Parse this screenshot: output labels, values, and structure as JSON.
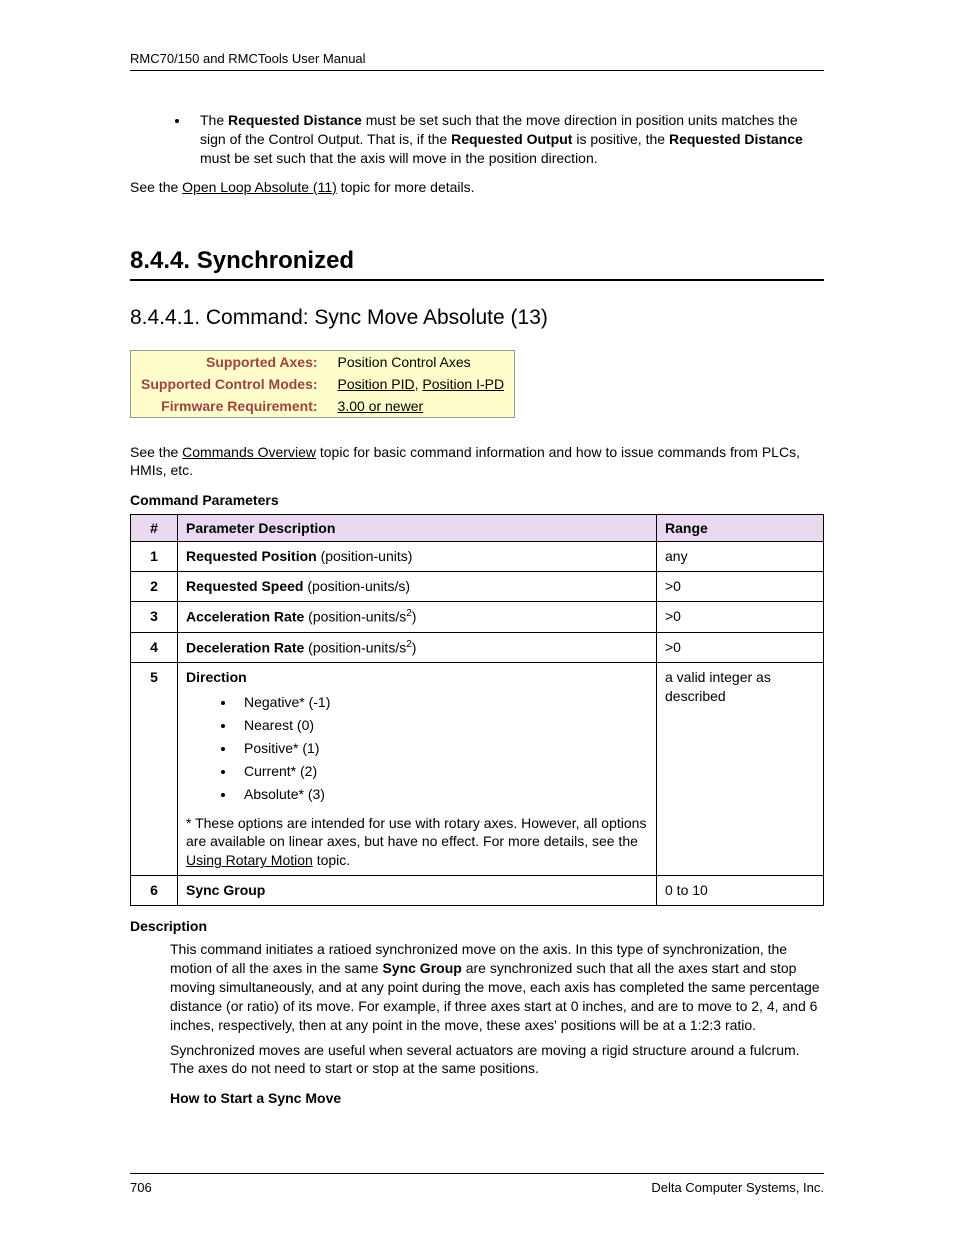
{
  "header": "RMC70/150 and RMCTools User Manual",
  "intro_bullet_pre": "The ",
  "intro_bullet_b1": "Requested Distance",
  "intro_bullet_mid1": " must be set such that the move direction in position units matches the sign of the Control Output. That is, if the ",
  "intro_bullet_b2": "Requested Output",
  "intro_bullet_mid2": " is positive, the ",
  "intro_bullet_b3": "Requested Distance",
  "intro_bullet_end": " must be set such that the axis will move in the position direction.",
  "see1_pre": "See the ",
  "see1_link": "Open Loop Absolute (11)",
  "see1_post": " topic for more details.",
  "h2": "8.4.4. Synchronized",
  "h3": "8.4.4.1. Command: Sync Move Absolute (13)",
  "info": {
    "r1l": "Supported Axes:",
    "r1v": "Position Control Axes",
    "r2l": "Supported Control Modes:",
    "r2v_a": "Position PID",
    "r2v_sep": ", ",
    "r2v_b": "Position I-PD",
    "r3l": "Firmware Requirement:",
    "r3v": "3.00 or newer"
  },
  "see2_pre": "See the ",
  "see2_link": "Commands Overview",
  "see2_post": " topic for basic command information and how to issue commands from PLCs, HMIs, etc.",
  "cmdparams_title": "Command Parameters",
  "th_num": "#",
  "th_desc": "Parameter Description",
  "th_range": "Range",
  "rows": {
    "r1": {
      "n": "1",
      "name": "Requested Position",
      "units": "  (position-units)",
      "range": "any"
    },
    "r2": {
      "n": "2",
      "name": "Requested Speed",
      "units": "  (position-units/s)",
      "range": ">0"
    },
    "r3": {
      "n": "3",
      "name": "Acceleration Rate",
      "units_pre": "  (position-units/s",
      "units_post": ")",
      "range": ">0"
    },
    "r4": {
      "n": "4",
      "name": "Deceleration Rate",
      "units_pre": "  (position-units/s",
      "units_post": ")",
      "range": ">0"
    },
    "r5": {
      "n": "5",
      "name": "Direction",
      "opts": {
        "a": "Negative* (-1)",
        "b": "Nearest (0)",
        "c": "Positive* (1)",
        "d": "Current* (2)",
        "e": "Absolute* (3)"
      },
      "note_pre": "* These options are intended for use with rotary axes. However, all options are available on linear axes, but have no effect. For more details, see the ",
      "note_link": "Using Rotary Motion",
      "note_post": " topic.",
      "range": "a valid integer as described"
    },
    "r6": {
      "n": "6",
      "name": "Sync Group",
      "range": "0 to 10"
    }
  },
  "desc_title": "Description",
  "desc_p1_pre": "This command initiates a ratioed synchronized move on the axis. In this type of synchronization, the motion of all the axes in the same ",
  "desc_p1_b": "Sync Group",
  "desc_p1_post": " are synchronized such that all the axes start and stop moving simultaneously, and at any point during the move, each axis has completed the same percentage distance (or ratio) of its move. For example, if three axes start at 0 inches, and are to move to 2, 4, and 6 inches, respectively, then at any point in the move, these axes' positions will be at a 1:2:3 ratio.",
  "desc_p2": "Synchronized moves are useful when several actuators are moving a rigid structure around a fulcrum. The axes do not need to start or stop at the same positions.",
  "howto": "How to Start a Sync Move",
  "footer_page": "706",
  "footer_company": "Delta Computer Systems, Inc."
}
